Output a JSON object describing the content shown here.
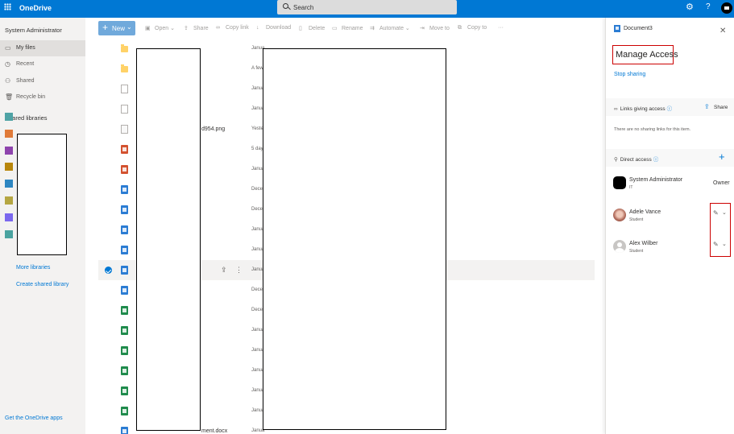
{
  "app": {
    "brand": "OneDrive"
  },
  "search": {
    "placeholder": "Search"
  },
  "header": {
    "settings_icon": "gear-icon",
    "help_label": "?",
    "account_icon": "avatar"
  },
  "leftnav": {
    "user": "System Administrator",
    "items": [
      {
        "label": "My files",
        "icon": "folder-icon",
        "active": true
      },
      {
        "label": "Recent",
        "icon": "clock-icon"
      },
      {
        "label": "Shared",
        "icon": "people-icon"
      },
      {
        "label": "Recycle bin",
        "icon": "trash-icon"
      }
    ],
    "shared_libraries_title": "Shared libraries",
    "library_colors": [
      "#4fa3a5",
      "#e07b39",
      "#8e44ad",
      "#b8860b",
      "#2e86c1",
      "#b5a642",
      "#7b68ee",
      "#4aa3a0"
    ],
    "more_libraries": "More libraries",
    "create_shared_library": "Create shared library",
    "get_apps": "Get the OneDrive apps"
  },
  "commandbar": {
    "new": "New",
    "open": "Open",
    "share": "Share",
    "copy_link": "Copy link",
    "download": "Download",
    "delete": "Delete",
    "rename": "Rename",
    "automate": "Automate",
    "move_to": "Move to",
    "copy_to": "Copy to",
    "more": "···"
  },
  "files": {
    "rows": [
      {
        "type": "folder",
        "name": "",
        "modified": "Janua"
      },
      {
        "type": "folder",
        "name": "",
        "modified": "A few"
      },
      {
        "type": "blank",
        "name": "",
        "modified": "Janua"
      },
      {
        "type": "blank",
        "name": "",
        "modified": "Janua"
      },
      {
        "type": "img",
        "name": "d954.png",
        "modified": "Yeste"
      },
      {
        "type": "ppt",
        "name": "",
        "modified": "5 day"
      },
      {
        "type": "ppt",
        "name": "",
        "modified": "Janua"
      },
      {
        "type": "doc",
        "name": "",
        "modified": "Dece"
      },
      {
        "type": "doc",
        "name": "",
        "modified": "Dece"
      },
      {
        "type": "doc",
        "name": "",
        "modified": "Janua"
      },
      {
        "type": "doc",
        "name": "",
        "modified": "Janua"
      },
      {
        "type": "doc",
        "name": "",
        "modified": "Janua",
        "selected": true
      },
      {
        "type": "doc",
        "name": "",
        "modified": "Dece"
      },
      {
        "type": "xls",
        "name": "",
        "modified": "Dece"
      },
      {
        "type": "xls",
        "name": "",
        "modified": "Janua"
      },
      {
        "type": "xls",
        "name": "",
        "modified": "Janua"
      },
      {
        "type": "xls",
        "name": "",
        "modified": "Janua"
      },
      {
        "type": "xls",
        "name": "",
        "modified": "Janua"
      },
      {
        "type": "xls",
        "name": "",
        "modified": "Janua"
      },
      {
        "type": "doc",
        "name": "ment.docx",
        "modified": "Janua"
      }
    ]
  },
  "panel": {
    "doc_name": "Document3",
    "title": "Manage Access",
    "stop_sharing": "Stop sharing",
    "links_title": "Links giving access",
    "share_label": "Share",
    "no_links": "There are no sharing links for this item.",
    "direct_title": "Direct access",
    "people": [
      {
        "name": "System Administrator",
        "role": "IT",
        "avatar": "black",
        "permission": "Owner"
      },
      {
        "name": "Adele Vance",
        "role": "Student",
        "avatar": "photo",
        "permission": "edit"
      },
      {
        "name": "Alex Wilber",
        "role": "Student",
        "avatar": "generic",
        "permission": "edit"
      }
    ]
  }
}
